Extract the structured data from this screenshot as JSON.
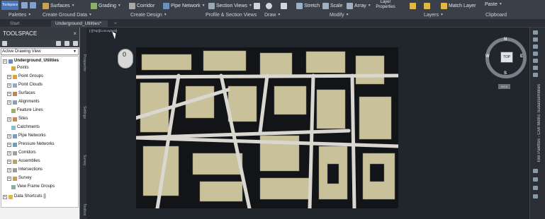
{
  "ribbon": {
    "toolspace_tab": "Toolspace",
    "buttons": {
      "surfaces": "Surfaces",
      "grading": "Grading",
      "corridor": "Corridor",
      "pipe_network": "Pipe Network",
      "section_views": "Section Views",
      "stretch": "Stretch",
      "scale": "Scale",
      "array": "Array",
      "layer_properties": "Layer Properties",
      "match_layer": "Match Layer",
      "paste": "Paste"
    },
    "panels": {
      "palettes": "Palettes",
      "create_ground_data": "Create Ground Data",
      "create_design": "Create Design",
      "profile_section_views": "Profile & Section Views",
      "draw": "Draw",
      "modify": "Modify",
      "layers": "Layers",
      "clipboard": "Clipboard"
    }
  },
  "doc_tabs": {
    "start": "Start",
    "active": "Underground_Utilities*",
    "add": "+"
  },
  "toolspace": {
    "title": "TOOLSPACE",
    "close": "×",
    "view_selector": "Active Drawing View",
    "tree": {
      "root": "Underground_Utilities",
      "items": [
        "Points",
        "Point Groups",
        "Point Clouds",
        "Surfaces",
        "Alignments",
        "Feature Lines",
        "Sites",
        "Catchments",
        "Pipe Networks",
        "Pressure Networks",
        "Corridors",
        "Assemblies",
        "Intersections",
        "Survey",
        "View Frame Groups"
      ],
      "shortcuts": "Data Shortcuts []"
    },
    "vertical_tabs": [
      "Prospector",
      "Settings",
      "Survey",
      "Toolbox"
    ]
  },
  "viewport": {
    "label": "[-][Top][Conceptual]",
    "mouse_number": "0",
    "viewcube": {
      "top": "TOP",
      "north": "N",
      "south": "S",
      "east": "E",
      "west": "W",
      "wcs": "WCS"
    }
  },
  "right_palette": {
    "label": "Tool Palettes - Civil Metric Subassemblies"
  },
  "colors": {
    "ribbon_bg": "#3a4049",
    "viewport_bg": "#21252c",
    "toolspace_tab": "#4a73b8",
    "building": "#c9c19a",
    "road": "#d9d7cf"
  }
}
